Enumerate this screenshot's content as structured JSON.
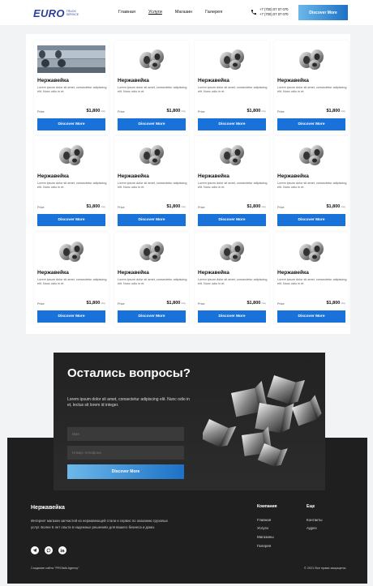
{
  "header": {
    "logo_main": "EURO",
    "logo_sub_1": "TRUCK",
    "logo_sub_2": "SERVICE",
    "nav": [
      "Главная",
      "Услуги",
      "Магазин",
      "Галерея"
    ],
    "phone_1": "+7 (700) 07 07 070",
    "phone_2": "+7 (700) 07 07 070",
    "cta_label": "Discover More"
  },
  "products": [
    {
      "title": "Нержавейка",
      "desc": "Lorem ipsum dolor sit amet, consectetur adipiscing elit. Nunc odio in et.",
      "price_label": "Price",
      "price": "$1,800",
      "unit": "/day",
      "button": "Discover More",
      "image": "pipes-photo"
    },
    {
      "title": "Нержавейка",
      "desc": "Lorem ipsum dolor sit amet, consectetur adipiscing elit. Nunc odio in et.",
      "price_label": "Price",
      "price": "$1,800",
      "unit": "/day",
      "button": "Discover More",
      "image": "pipe-fitting"
    },
    {
      "title": "Нержавейка",
      "desc": "Lorem ipsum dolor sit amet, consectetur adipiscing elit. Nunc odio in et.",
      "price_label": "Price",
      "price": "$1,800",
      "unit": "/day",
      "button": "Discover More",
      "image": "pipe-fitting"
    },
    {
      "title": "Нержавейка",
      "desc": "Lorem ipsum dolor sit amet, consectetur adipiscing elit. Nunc odio in et.",
      "price_label": "Price",
      "price": "$1,800",
      "unit": "/day",
      "button": "Discover More",
      "image": "pipe-fitting"
    },
    {
      "title": "Нержавейка",
      "desc": "Lorem ipsum dolor sit amet, consectetur adipiscing elit. Nunc odio in et.",
      "price_label": "Price",
      "price": "$1,800",
      "unit": "/day",
      "button": "Discover More",
      "image": "pipe-fitting"
    },
    {
      "title": "Нержавейка",
      "desc": "Lorem ipsum dolor sit amet, consectetur adipiscing elit. Nunc odio in et.",
      "price_label": "Price",
      "price": "$1,800",
      "unit": "/day",
      "button": "Discover More",
      "image": "pipe-fitting"
    },
    {
      "title": "Нержавейка",
      "desc": "Lorem ipsum dolor sit amet, consectetur adipiscing elit. Nunc odio in et.",
      "price_label": "Price",
      "price": "$1,800",
      "unit": "/day",
      "button": "Discover More",
      "image": "pipe-fitting"
    },
    {
      "title": "Нержавейка",
      "desc": "Lorem ipsum dolor sit amet, consectetur adipiscing elit. Nunc odio in et.",
      "price_label": "Price",
      "price": "$1,800",
      "unit": "/day",
      "button": "Discover More",
      "image": "pipe-fitting"
    },
    {
      "title": "Нержавейка",
      "desc": "Lorem ipsum dolor sit amet, consectetur adipiscing elit. Nunc odio in et.",
      "price_label": "Price",
      "price": "$1,800",
      "unit": "/day",
      "button": "Discover More",
      "image": "pipe-fitting"
    },
    {
      "title": "Нержавейка",
      "desc": "Lorem ipsum dolor sit amet, consectetur adipiscing elit. Nunc odio in et.",
      "price_label": "Price",
      "price": "$1,800",
      "unit": "/day",
      "button": "Discover More",
      "image": "pipe-fitting"
    },
    {
      "title": "Нержавейка",
      "desc": "Lorem ipsum dolor sit amet, consectetur adipiscing elit. Nunc odio in et.",
      "price_label": "Price",
      "price": "$1,800",
      "unit": "/day",
      "button": "Discover More",
      "image": "pipe-fitting"
    },
    {
      "title": "Нержавейка",
      "desc": "Lorem ipsum dolor sit amet, consectetur adipiscing elit. Nunc odio in et.",
      "price_label": "Price",
      "price": "$1,800",
      "unit": "/day",
      "button": "Discover More",
      "image": "pipe-fitting"
    }
  ],
  "contact": {
    "heading": "Остались вопросы?",
    "text": "Lorem ipsum dolor sit amet, consectetur adipiscing elit. Nunc odio in et, lectus sit lorem id integer.",
    "name_placeholder": "Имя",
    "phone_placeholder": "Номер телефона",
    "button": "Discover More"
  },
  "footer": {
    "title": "Нержавейка",
    "desc": "Интернет магазин запчастей из нержавеющей стали и сервис по оказанию грузовых услуг. Более 5 лет опыта в надежных решениях для вашего бизнеса и дома.",
    "socials": [
      "telegram-icon",
      "whatsapp-icon",
      "linkedin-icon"
    ],
    "col1_title": "Компания",
    "col1_links": [
      "Главная",
      "Услуги",
      "Магазины",
      "Галерея"
    ],
    "col2_title": "Еще",
    "col2_links": [
      "Контакты",
      "Адрес"
    ],
    "bottom_left": "Создание сайта \"PROtalk Agency\"",
    "bottom_right": "© 2021 Все права защищены"
  },
  "colors": {
    "accent": "#1872d9",
    "logo": "#2a3f9e",
    "dark": "#1f1f1f"
  }
}
